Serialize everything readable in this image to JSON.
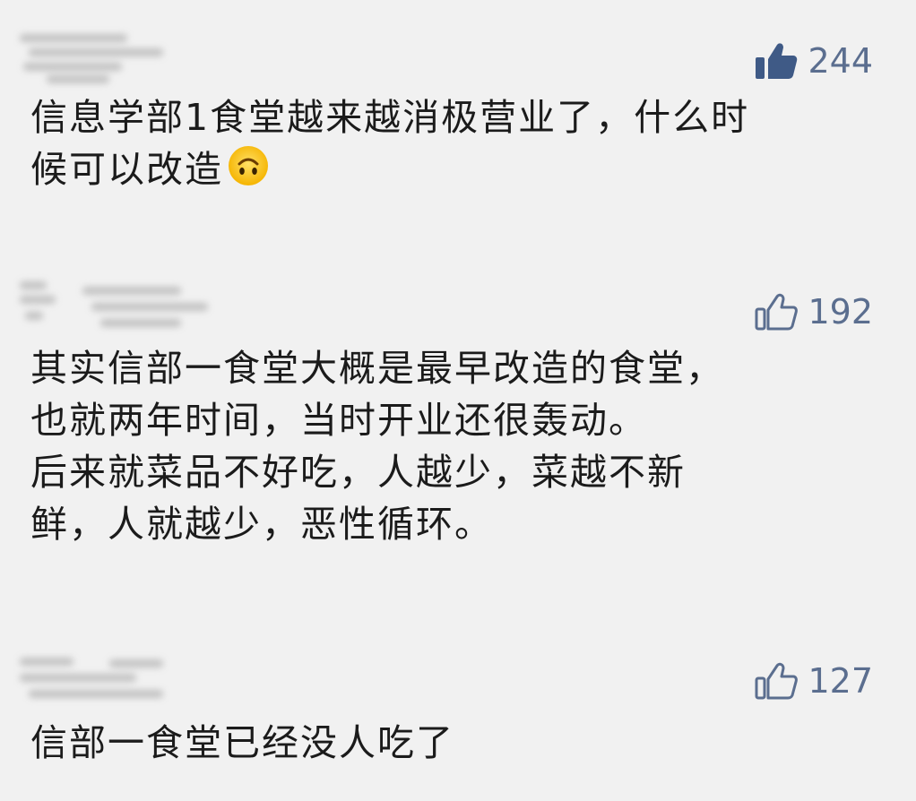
{
  "comments": [
    {
      "likes": "244",
      "liked": true,
      "lines": [
        "信息学部1食堂越来越消极营业了，什么时",
        "候可以改造"
      ],
      "emoji": "upside-down-face"
    },
    {
      "likes": "192",
      "liked": false,
      "lines": [
        "其实信部一食堂大概是最早改造的食堂，",
        "也就两年时间，当时开业还很轰动。",
        "后来就菜品不好吃，人越少，菜越不新",
        "鲜，人就越少，恶性循环。"
      ]
    },
    {
      "likes": "127",
      "liked": false,
      "lines": [
        "信部一食堂已经没人吃了"
      ]
    }
  ],
  "colors": {
    "background": "#f1f1f1",
    "like_accent": "#5b6e8f",
    "text": "#1b1b1b"
  }
}
